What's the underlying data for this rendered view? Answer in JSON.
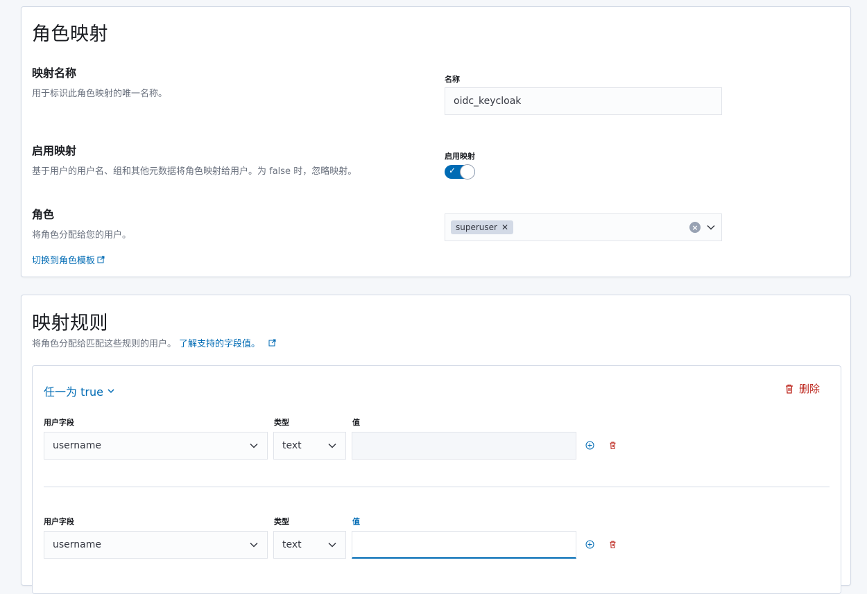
{
  "role_mapping": {
    "title": "角色映射",
    "mapping_name": {
      "title": "映射名称",
      "description": "用于标识此角色映射的唯一名称。",
      "label": "名称",
      "value": "oidc_keycloak"
    },
    "enable_mapping": {
      "title": "启用映射",
      "description": "基于用户的用户名、组和其他元数据将角色映射给用户。为 false 时，忽略映射。",
      "label": "启用映射",
      "enabled": true
    },
    "roles": {
      "title": "角色",
      "description": "将角色分配给您的用户。",
      "selected": [
        "superuser"
      ],
      "switch_link": "切换到角色模板"
    }
  },
  "mapping_rules": {
    "title": "映射规则",
    "description": "将角色分配给匹配这些规则的用户。",
    "learn_link": "了解支持的字段值。",
    "group_selector": "任一为 true",
    "delete_label": "删除",
    "rules": [
      {
        "user_field_label": "用户字段",
        "user_field_value": "username",
        "type_label": "类型",
        "type_value": "text",
        "value_label": "值",
        "value": ""
      },
      {
        "user_field_label": "用户字段",
        "user_field_value": "username",
        "type_label": "类型",
        "type_value": "text",
        "value_label": "值",
        "value": ""
      }
    ]
  },
  "colors": {
    "primary": "#006bb4",
    "danger": "#bd271e",
    "border": "#d3dae6"
  }
}
